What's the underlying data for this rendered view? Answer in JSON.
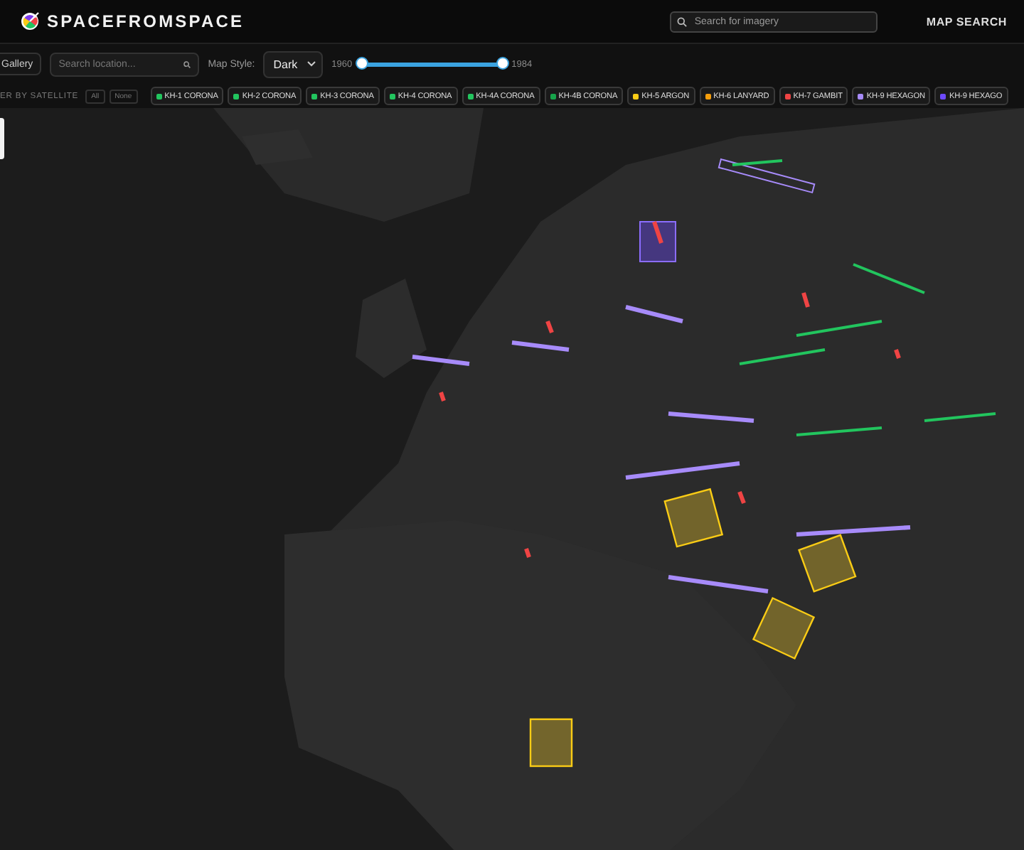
{
  "header": {
    "brand": "SPACEFROMSPACE",
    "search": {
      "placeholder": "Search for imagery"
    },
    "nav_link": "MAP SEARCH"
  },
  "toolbar": {
    "gallery_button": "Gallery",
    "location_search": {
      "placeholder": "Search location..."
    },
    "map_style_label": "Map Style:",
    "map_style_value": "Dark",
    "year_start": "1960",
    "year_end": "1984",
    "level": 1
  },
  "filter": {
    "label": "ER BY SATELLITE",
    "buttons": [
      "All",
      "None"
    ],
    "satellites": [
      {
        "label": "KH-1 CORONA",
        "color": "#22c55e"
      },
      {
        "label": "KH-2 CORONA",
        "color": "#22c55e"
      },
      {
        "label": "KH-3 CORONA",
        "color": "#22c55e"
      },
      {
        "label": "KH-4 CORONA",
        "color": "#22c55e"
      },
      {
        "label": "KH-4A CORONA",
        "color": "#22c55e"
      },
      {
        "label": "KH-4B CORONA",
        "color": "#16a34a"
      },
      {
        "label": "KH-5 ARGON",
        "color": "#facc15"
      },
      {
        "label": "KH-6 LANYARD",
        "color": "#f59e0b"
      },
      {
        "label": "KH-7 GAMBIT",
        "color": "#ef4444"
      },
      {
        "label": "KH-9 HEXAGON",
        "color": "#a78bfa"
      },
      {
        "label": "KH-9 HEXAGO",
        "color": "#6d4aff"
      }
    ]
  }
}
